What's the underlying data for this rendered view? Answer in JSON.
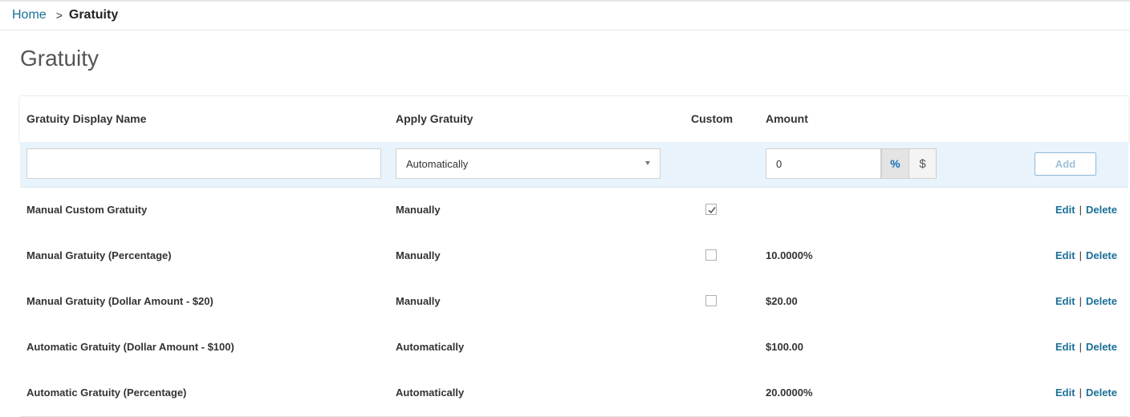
{
  "breadcrumb": {
    "home": "Home",
    "separator": ">",
    "current": "Gratuity"
  },
  "page": {
    "title": "Gratuity"
  },
  "table": {
    "headers": {
      "name": "Gratuity Display Name",
      "apply": "Apply Gratuity",
      "custom": "Custom",
      "amount": "Amount"
    },
    "add_row": {
      "name_value": "",
      "apply_value": "Automatically",
      "amount_value": "0",
      "unit_percent": "%",
      "unit_dollar": "$",
      "unit_selected": "%",
      "add_label": "Add"
    },
    "rows": [
      {
        "name": "Manual Custom Gratuity",
        "apply": "Manually",
        "custom": true,
        "amount": "",
        "edit": "Edit",
        "sep": "|",
        "delete": "Delete"
      },
      {
        "name": "Manual Gratuity (Percentage)",
        "apply": "Manually",
        "custom": false,
        "amount": "10.0000%",
        "edit": "Edit",
        "sep": "|",
        "delete": "Delete"
      },
      {
        "name": "Manual Gratuity (Dollar Amount - $20)",
        "apply": "Manually",
        "custom": false,
        "amount": "$20.00",
        "edit": "Edit",
        "sep": "|",
        "delete": "Delete"
      },
      {
        "name": "Automatic Gratuity (Dollar Amount - $100)",
        "apply": "Automatically",
        "amount": "$100.00",
        "edit": "Edit",
        "sep": "|",
        "delete": "Delete"
      },
      {
        "name": "Automatic Gratuity (Percentage)",
        "apply": "Automatically",
        "amount": "20.0000%",
        "edit": "Edit",
        "sep": "|",
        "delete": "Delete"
      }
    ]
  },
  "colors": {
    "link": "#1a6f97",
    "add_row_bg": "#e9f3fb",
    "unit_active": "#1a6fb3"
  },
  "icons": {
    "checkbox_checked": "checkmark-icon",
    "select_caret": "caret-down-icon"
  }
}
